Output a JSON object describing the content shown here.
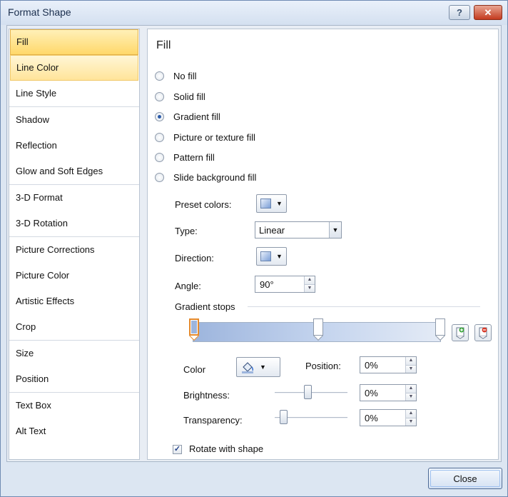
{
  "window": {
    "title": "Format Shape",
    "help_glyph": "?",
    "close_glyph": "✕"
  },
  "nav": {
    "groups": [
      {
        "items": [
          {
            "label": "Fill"
          },
          {
            "label": "Line Color"
          },
          {
            "label": "Line Style"
          }
        ]
      },
      {
        "items": [
          {
            "label": "Shadow"
          },
          {
            "label": "Reflection"
          },
          {
            "label": "Glow and Soft Edges"
          }
        ]
      },
      {
        "items": [
          {
            "label": "3-D Format"
          },
          {
            "label": "3-D Rotation"
          }
        ]
      },
      {
        "items": [
          {
            "label": "Picture Corrections"
          },
          {
            "label": "Picture Color"
          },
          {
            "label": "Artistic Effects"
          },
          {
            "label": "Crop"
          }
        ]
      },
      {
        "items": [
          {
            "label": "Size"
          },
          {
            "label": "Position"
          }
        ]
      },
      {
        "items": [
          {
            "label": "Text Box"
          },
          {
            "label": "Alt Text"
          }
        ]
      }
    ]
  },
  "fill": {
    "section_title": "Fill",
    "options": [
      {
        "label": "No fill",
        "checked": false
      },
      {
        "label": "Solid fill",
        "checked": false
      },
      {
        "label": "Gradient fill",
        "checked": true
      },
      {
        "label": "Picture or texture fill",
        "checked": false
      },
      {
        "label": "Pattern fill",
        "checked": false
      },
      {
        "label": "Slide background fill",
        "checked": false
      }
    ],
    "preset_colors_label": "Preset colors:",
    "type_label": "Type:",
    "type_value": "Linear",
    "direction_label": "Direction:",
    "angle_label": "Angle:",
    "angle_value": "90°",
    "gradient_stops_label": "Gradient stops",
    "color_label": "Color",
    "position_label": "Position:",
    "position_value": "0%",
    "brightness_label": "Brightness:",
    "brightness_value": "0%",
    "transparency_label": "Transparency:",
    "transparency_value": "0%",
    "rotate_label": "Rotate with shape",
    "rotate_checked": true
  },
  "footer": {
    "close_label": "Close"
  }
}
